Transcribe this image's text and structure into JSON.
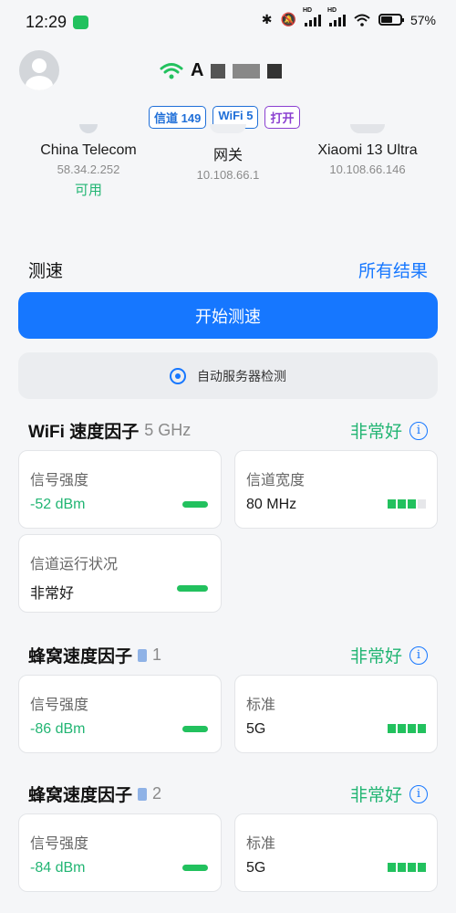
{
  "status_bar": {
    "time": "12:29",
    "battery": "57%"
  },
  "header": {
    "wifi_icon": "wifi-icon",
    "ssid_visible": "A",
    "chips": {
      "channel": "信道 149",
      "standard": "WiFi 5",
      "open": "打开"
    }
  },
  "nodes": [
    {
      "name": "China Telecom",
      "ip": "58.34.2.252",
      "state": "可用"
    },
    {
      "name": "网关",
      "ip": "10.108.66.1"
    },
    {
      "name": "Xiaomi 13 Ultra",
      "ip": "10.108.66.146"
    }
  ],
  "speedtest": {
    "title": "测速",
    "all_results": "所有结果",
    "start": "开始测速",
    "auto_server": "自动服务器检测"
  },
  "wifi_section": {
    "title": "WiFi 速度因子",
    "band": "5 GHz",
    "rating": "非常好",
    "cards": {
      "signal": {
        "label": "信号强度",
        "value": "-52 dBm"
      },
      "width": {
        "label": "信道宽度",
        "value": "80 MHz"
      },
      "channel": {
        "label": "信道运行状况",
        "value": "非常好"
      }
    }
  },
  "cell_section_1": {
    "title": "蜂窝速度因子",
    "sim": "1",
    "rating": "非常好",
    "cards": {
      "signal": {
        "label": "信号强度",
        "value": "-86 dBm"
      },
      "standard": {
        "label": "标准",
        "value": "5G"
      }
    }
  },
  "cell_section_2": {
    "title": "蜂窝速度因子",
    "sim": "2",
    "rating": "非常好",
    "cards": {
      "signal": {
        "label": "信号强度",
        "value": "-84 dBm"
      },
      "standard": {
        "label": "标准",
        "value": "5G"
      }
    }
  },
  "colors": {
    "accent": "#1677ff",
    "good": "#22b573"
  }
}
